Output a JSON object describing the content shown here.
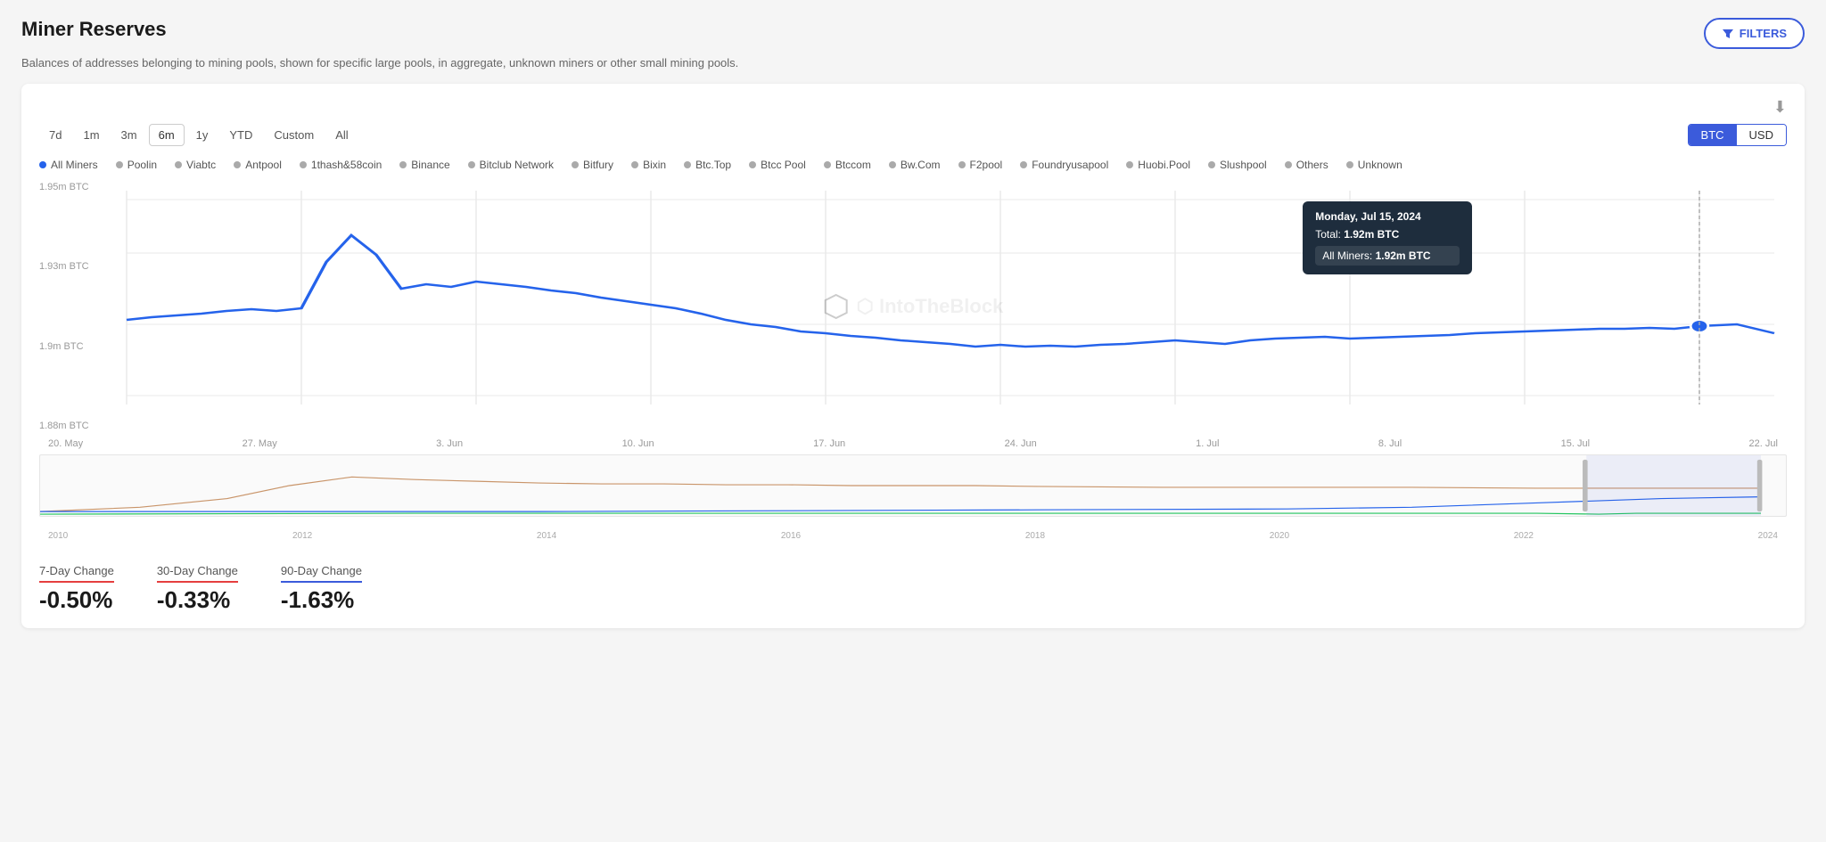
{
  "page": {
    "title": "Miner Reserves",
    "description": "Balances of addresses belonging to mining pools, shown for specific large pools, in aggregate, unknown miners or other small mining pools."
  },
  "filters_button": {
    "label": "FILTERS"
  },
  "time_buttons": [
    {
      "label": "7d",
      "active": false
    },
    {
      "label": "1m",
      "active": false
    },
    {
      "label": "3m",
      "active": false
    },
    {
      "label": "6m",
      "active": true
    },
    {
      "label": "1y",
      "active": false
    },
    {
      "label": "YTD",
      "active": false
    },
    {
      "label": "Custom",
      "active": false
    },
    {
      "label": "All",
      "active": false
    }
  ],
  "currency_buttons": [
    {
      "label": "BTC",
      "active": true
    },
    {
      "label": "USD",
      "active": false
    }
  ],
  "legend_items": [
    {
      "label": "All Miners",
      "color": "#2563eb",
      "active": true
    },
    {
      "label": "Poolin",
      "color": "#aaa",
      "active": false
    },
    {
      "label": "Viabtc",
      "color": "#aaa",
      "active": false
    },
    {
      "label": "Antpool",
      "color": "#aaa",
      "active": false
    },
    {
      "label": "1thash&58coin",
      "color": "#aaa",
      "active": false
    },
    {
      "label": "Binance",
      "color": "#aaa",
      "active": false
    },
    {
      "label": "Bitclub Network",
      "color": "#aaa",
      "active": false
    },
    {
      "label": "Bitfury",
      "color": "#aaa",
      "active": false
    },
    {
      "label": "Bixin",
      "color": "#aaa",
      "active": false
    },
    {
      "label": "Btc.Top",
      "color": "#aaa",
      "active": false
    },
    {
      "label": "Btcc Pool",
      "color": "#aaa",
      "active": false
    },
    {
      "label": "Btccom",
      "color": "#aaa",
      "active": false
    },
    {
      "label": "Bw.Com",
      "color": "#aaa",
      "active": false
    },
    {
      "label": "F2pool",
      "color": "#aaa",
      "active": false
    },
    {
      "label": "Foundryusapool",
      "color": "#aaa",
      "active": false
    },
    {
      "label": "Huobi.Pool",
      "color": "#aaa",
      "active": false
    },
    {
      "label": "Slushpool",
      "color": "#aaa",
      "active": false
    },
    {
      "label": "Others",
      "color": "#aaa",
      "active": false
    },
    {
      "label": "Unknown",
      "color": "#aaa",
      "active": false
    }
  ],
  "y_axis": {
    "labels": [
      "1.95m BTC",
      "1.93m BTC",
      "1.9m BTC",
      "1.88m BTC"
    ]
  },
  "x_axis": {
    "labels": [
      "20. May",
      "27. May",
      "3. Jun",
      "10. Jun",
      "17. Jun",
      "24. Jun",
      "1. Jul",
      "8. Jul",
      "15. Jul",
      "22. Jul"
    ]
  },
  "tooltip": {
    "date": "Monday, Jul 15, 2024",
    "total_label": "Total:",
    "total_value": "1.92m BTC",
    "miners_label": "All Miners:",
    "miners_value": "1.92m BTC"
  },
  "mini_x_axis": {
    "labels": [
      "2010",
      "2012",
      "2014",
      "2016",
      "2018",
      "2020",
      "2022",
      "2024"
    ]
  },
  "changes": [
    {
      "label": "7-Day Change",
      "value": "-0.50%",
      "color": "#e53e3e"
    },
    {
      "label": "30-Day Change",
      "value": "-0.33%",
      "color": "#e53e3e"
    },
    {
      "label": "90-Day Change",
      "value": "-1.63%",
      "color": "#e53e3e"
    }
  ],
  "watermark": "⬡ IntoTheBlock"
}
